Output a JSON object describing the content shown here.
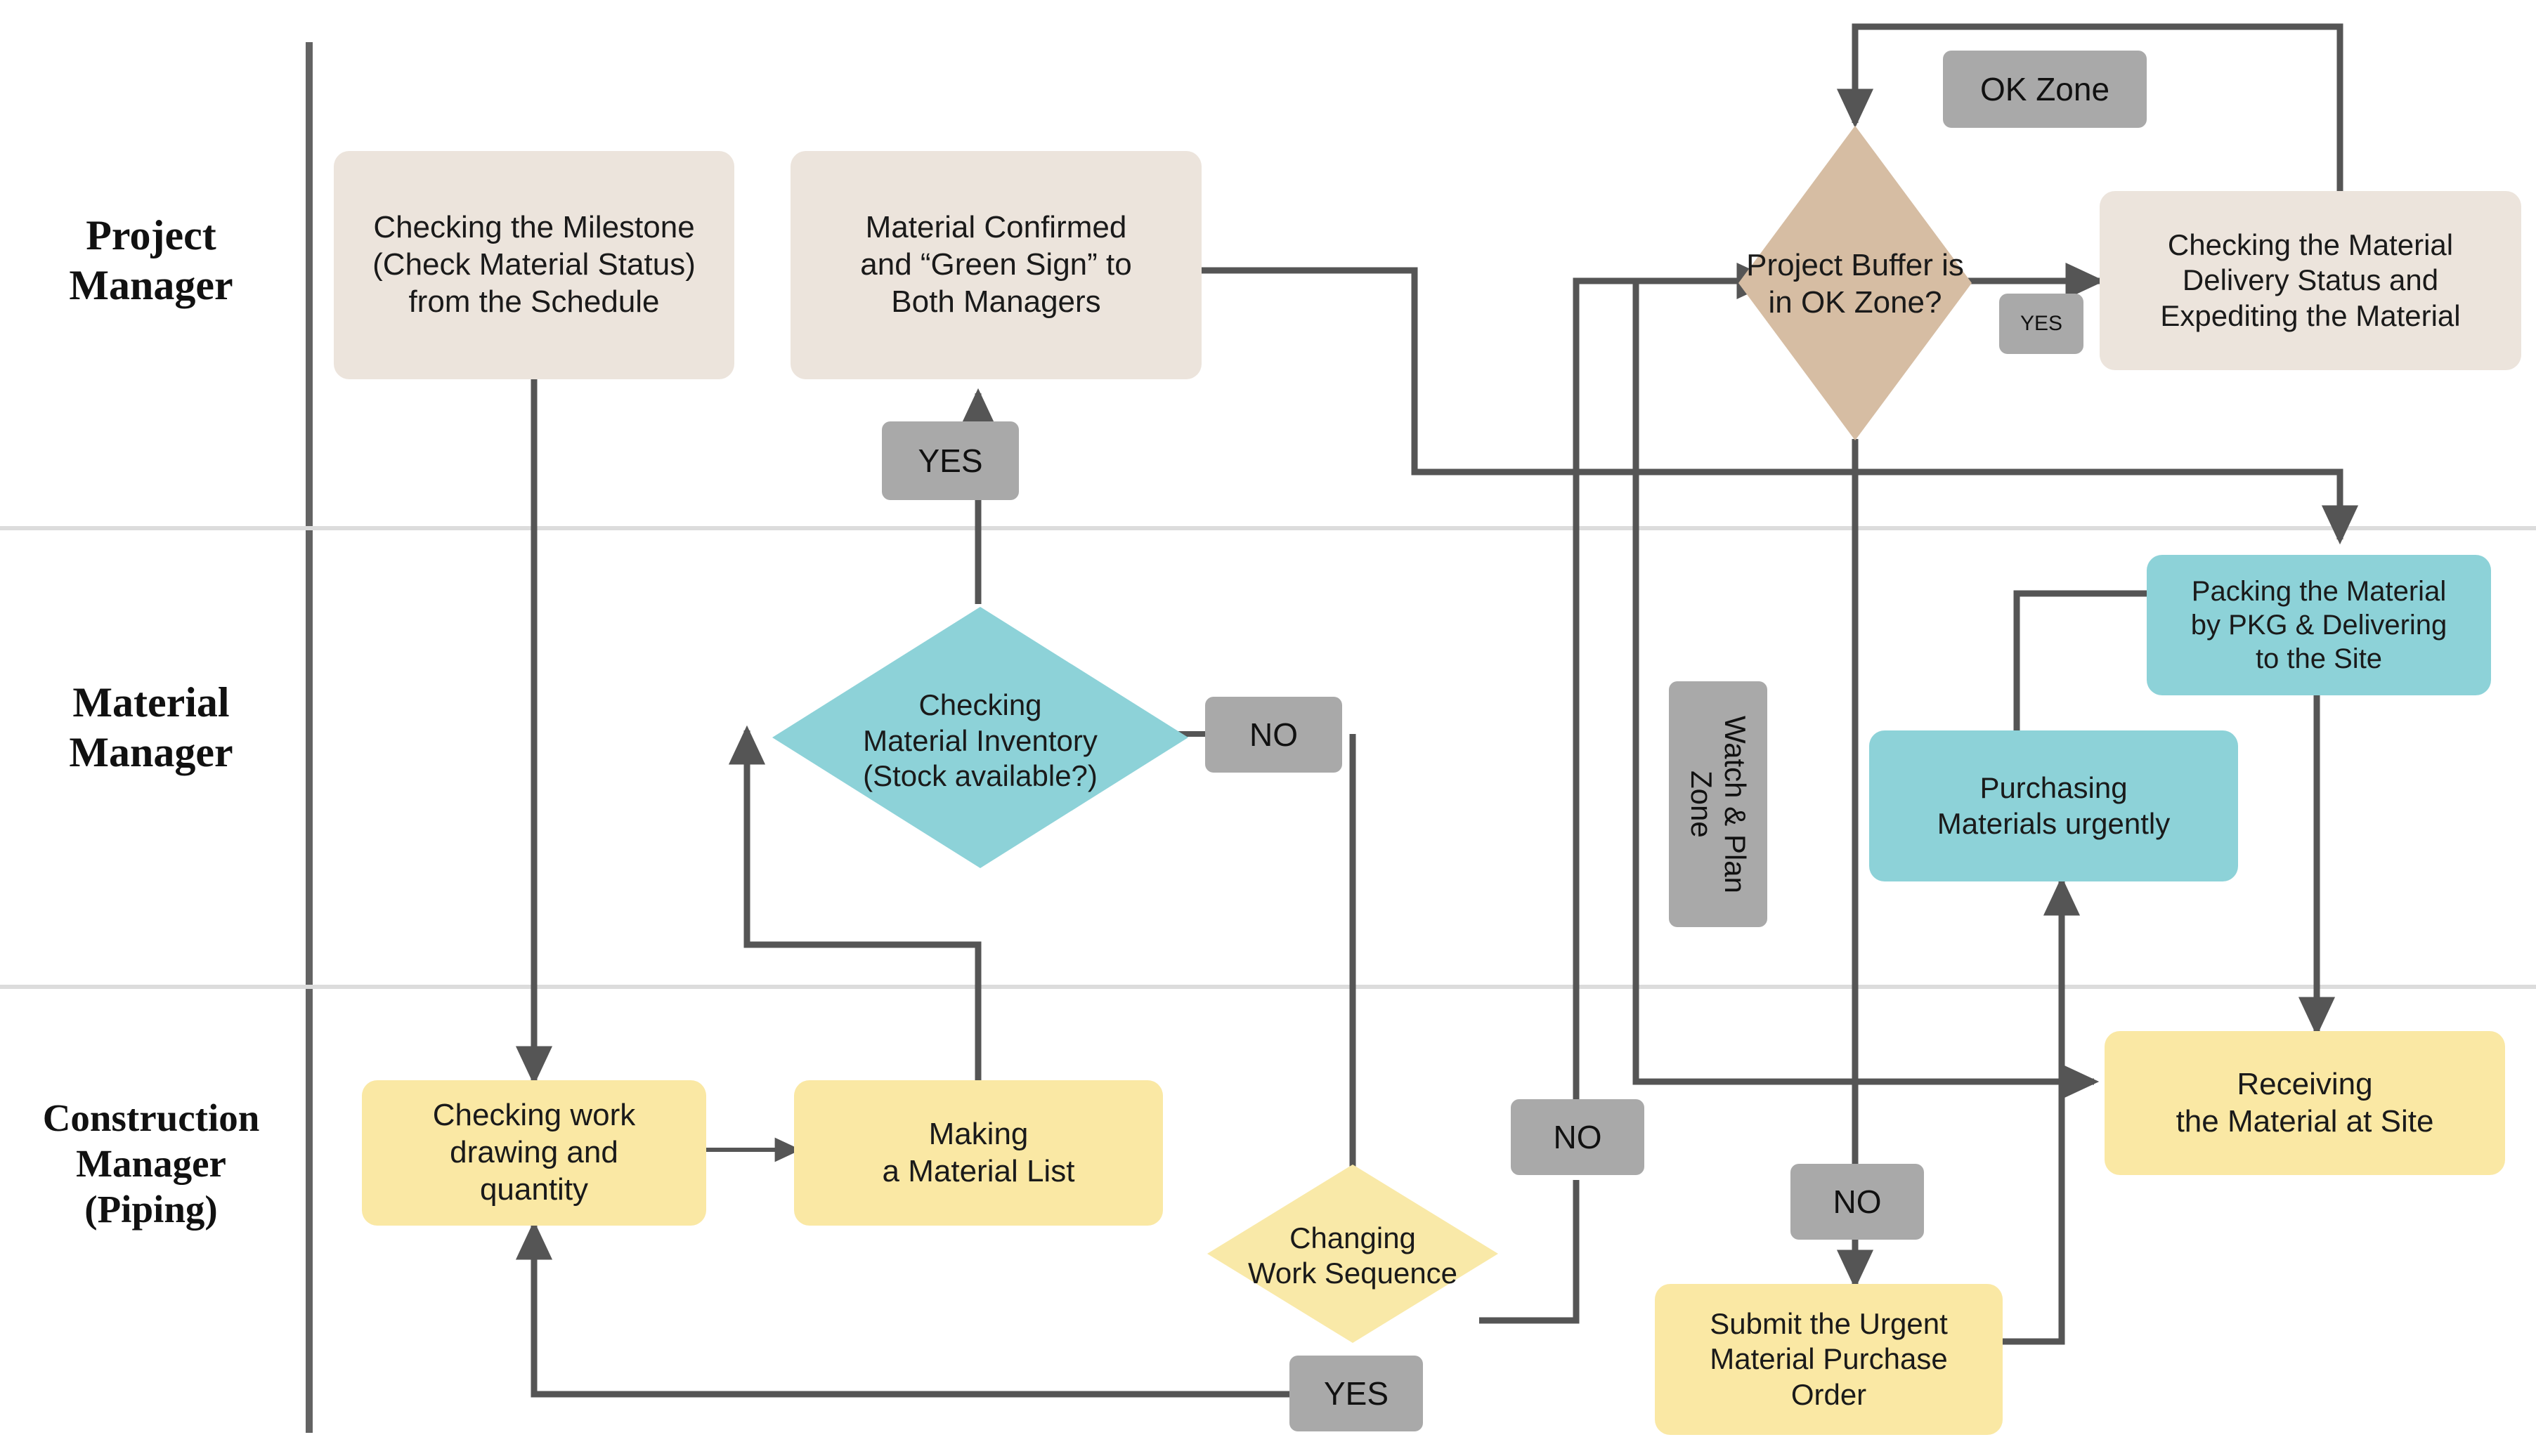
{
  "diagram": {
    "title": "Material management swimlane flowchart",
    "background": "#ffffff",
    "line_color": "#555555",
    "lane_divider_color": "#d9d9d9",
    "lane_axis_color": "#636363"
  },
  "lanes": [
    {
      "id": "pm",
      "name": "project-manager-lane",
      "lines": [
        "Project",
        "Manager"
      ]
    },
    {
      "id": "mm",
      "name": "material-manager-lane",
      "lines": [
        "Material",
        "Manager"
      ]
    },
    {
      "id": "cm",
      "name": "construction-manager-lane",
      "lines": [
        "Construction",
        "Manager",
        "(Piping)"
      ]
    }
  ],
  "palette": {
    "pm_fill": "#ece4dc",
    "diamond_tan": "#d6bda3",
    "mm_fill": "#8dd2d8",
    "cm_fill": "#fae8a4",
    "cm_diamond": "#f9e9a8",
    "tag_fill": "#a9a9a9"
  },
  "nodes": [
    {
      "id": "n1",
      "name": "checking-milestone-box",
      "lane": "pm",
      "shape": "rounded-rect",
      "text": "Checking the Milestone\n(Check Material Status)\nfrom the Schedule",
      "fill": "#ece4dc"
    },
    {
      "id": "n2",
      "name": "material-confirmed-box",
      "lane": "pm",
      "shape": "rounded-rect",
      "text": "Material Confirmed\nand “Green Sign” to\nBoth Managers",
      "fill": "#ece4dc"
    },
    {
      "id": "n3",
      "name": "project-buffer-ok-zone-decision",
      "lane": "pm",
      "shape": "diamond",
      "text": "Project Buffer is\nin OK Zone?",
      "fill": "#d6bda3"
    },
    {
      "id": "n4",
      "name": "checking-material-delivery-box",
      "lane": "pm",
      "shape": "rounded-rect",
      "text": "Checking the Material\nDelivery Status and\nExpediting the Material",
      "fill": "#ece4dc"
    },
    {
      "id": "n5",
      "name": "checking-material-inventory-decision",
      "lane": "mm",
      "shape": "diamond",
      "text": "Checking\nMaterial Inventory\n(Stock available?)",
      "fill": "#8dd2d8"
    },
    {
      "id": "n6",
      "name": "packing-material-box",
      "lane": "mm",
      "shape": "rounded-rect",
      "text": "Packing the Material\nby PKG & Delivering\nto the Site",
      "fill": "#8dd2d8"
    },
    {
      "id": "n7",
      "name": "purchasing-materials-box",
      "lane": "mm",
      "shape": "rounded-rect",
      "text": "Purchasing\nMaterials urgently",
      "fill": "#8dd2d8"
    },
    {
      "id": "n8",
      "name": "checking-work-drawing-box",
      "lane": "cm",
      "shape": "rounded-rect",
      "text": "Checking work\ndrawing and\nquantity",
      "fill": "#fae8a4"
    },
    {
      "id": "n9",
      "name": "making-material-list-box",
      "lane": "cm",
      "shape": "rounded-rect",
      "text": "Making\na Material List",
      "fill": "#fae8a4"
    },
    {
      "id": "n10",
      "name": "changing-work-sequence-decision",
      "lane": "cm",
      "shape": "diamond",
      "text": "Changing\nWork Sequence",
      "fill": "#f9e9a8"
    },
    {
      "id": "n11",
      "name": "submit-urgent-purchase-order-box",
      "lane": "cm",
      "shape": "rounded-rect",
      "text": "Submit the Urgent\nMaterial Purchase\nOrder",
      "fill": "#fae8a4"
    },
    {
      "id": "n12",
      "name": "receiving-material-at-site-box",
      "lane": "cm",
      "shape": "rounded-rect",
      "text": "Receiving\nthe Material at Site",
      "fill": "#fae8a4"
    }
  ],
  "tags": [
    {
      "id": "t_okzone",
      "name": "ok-zone-tag",
      "text": "OK Zone",
      "orientation": "horizontal"
    },
    {
      "id": "t_yes_pm",
      "name": "yes-tag-buffer",
      "text": "YES",
      "orientation": "horizontal"
    },
    {
      "id": "t_yes_mm",
      "name": "yes-tag-inventory",
      "text": "YES",
      "orientation": "horizontal"
    },
    {
      "id": "t_no_mm",
      "name": "no-tag-inventory",
      "text": "NO",
      "orientation": "horizontal"
    },
    {
      "id": "t_watchplan",
      "name": "watch-plan-zone-tag",
      "text": "Watch & Plan Zone",
      "orientation": "vertical"
    },
    {
      "id": "t_no_seq",
      "name": "no-tag-sequence",
      "text": "NO",
      "orientation": "horizontal"
    },
    {
      "id": "t_no_buffer",
      "name": "no-tag-buffer",
      "text": "NO",
      "orientation": "horizontal"
    },
    {
      "id": "t_yes_seq",
      "name": "yes-tag-sequence",
      "text": "YES",
      "orientation": "horizontal"
    }
  ],
  "chart_data": {
    "type": "diagram",
    "subtype": "swimlane-flowchart",
    "lanes": [
      "Project Manager",
      "Material Manager",
      "Construction Manager (Piping)"
    ],
    "nodes": [
      "Checking the Milestone (Check Material Status) from the Schedule",
      "Material Confirmed and “Green Sign” to Both Managers",
      "Project Buffer is in OK Zone?",
      "Checking the Material Delivery Status and Expediting the Material",
      "Checking Material Inventory (Stock available?)",
      "Packing the Material by PKG & Delivering to the Site",
      "Purchasing Materials urgently",
      "Checking work drawing and quantity",
      "Making a Material List",
      "Changing Work Sequence",
      "Submit the Urgent Material Purchase Order",
      "Receiving the Material at Site"
    ],
    "edge_labels": [
      "YES",
      "NO",
      "YES",
      "NO",
      "NO",
      "YES",
      "OK Zone",
      "Watch & Plan Zone"
    ],
    "edges": [
      {
        "from": "Checking the Milestone (Check Material Status) from the Schedule",
        "to": "Checking work drawing and quantity",
        "label": ""
      },
      {
        "from": "Checking work drawing and quantity",
        "to": "Making a Material List",
        "label": ""
      },
      {
        "from": "Making a Material List",
        "to": "Checking Material Inventory (Stock available?)",
        "label": ""
      },
      {
        "from": "Checking Material Inventory (Stock available?)",
        "to": "Material Confirmed and “Green Sign” to Both Managers",
        "label": "YES"
      },
      {
        "from": "Checking Material Inventory (Stock available?)",
        "to": "Changing Work Sequence",
        "label": "NO"
      },
      {
        "from": "Changing Work Sequence",
        "to": "Checking work drawing and quantity",
        "label": "YES"
      },
      {
        "from": "Changing Work Sequence",
        "to": "Project Buffer is in OK Zone?",
        "label": "NO"
      },
      {
        "from": "Material Confirmed and “Green Sign” to Both Managers",
        "to": "Project Buffer is in OK Zone?",
        "label": ""
      },
      {
        "from": "Project Buffer is in OK Zone?",
        "to": "Checking the Material Delivery Status and Expediting the Material",
        "label": "YES"
      },
      {
        "from": "Checking the Material Delivery Status and Expediting the Material",
        "to": "Project Buffer is in OK Zone?",
        "label": "OK Zone"
      },
      {
        "from": "Project Buffer is in OK Zone?",
        "to": "Submit the Urgent Material Purchase Order",
        "label": "NO"
      },
      {
        "from": "Submit the Urgent Material Purchase Order",
        "to": "Purchasing Materials urgently",
        "label": ""
      },
      {
        "from": "Purchasing Materials urgently",
        "to": "Packing the Material by PKG & Delivering to the Site",
        "label": ""
      },
      {
        "from": "Packing the Material by PKG & Delivering to the Site",
        "to": "Receiving the Material at Site",
        "label": ""
      },
      {
        "from": "Project Buffer is in OK Zone?",
        "to": "Receiving the Material at Site",
        "label": ""
      }
    ]
  }
}
